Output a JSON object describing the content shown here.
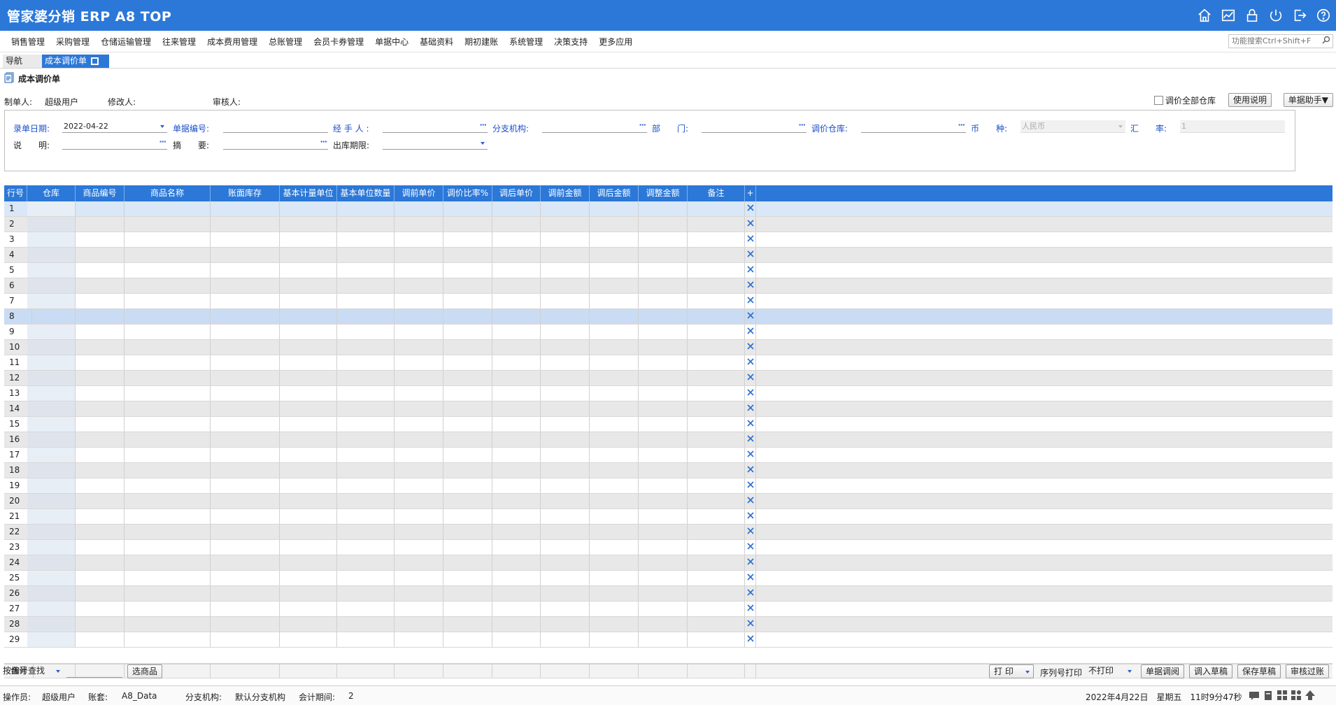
{
  "app": {
    "title": "管家婆分销 ERP A8 TOP"
  },
  "title_icons": [
    "home-icon",
    "chart-icon",
    "lock-icon",
    "power-icon",
    "exit-icon",
    "help-icon"
  ],
  "menu": [
    "销售管理",
    "采购管理",
    "仓储运输管理",
    "往来管理",
    "成本费用管理",
    "总账管理",
    "会员卡券管理",
    "单据中心",
    "基础资料",
    "期初建账",
    "系统管理",
    "决策支持",
    "更多应用"
  ],
  "search": {
    "placeholder": "功能搜索Ctrl+Shift+F"
  },
  "tabs": {
    "nav": "导航",
    "active": "成本调价单"
  },
  "page": {
    "title": "成本调价单"
  },
  "info": {
    "maker_label": "制单人:",
    "maker_value": "超级用户",
    "modifier_label": "修改人:",
    "auditor_label": "审核人:",
    "all_wh_label": "调价全部仓库",
    "help_button": "使用说明",
    "assist_button": "单据助手▼"
  },
  "form": {
    "date_label": "录单日期:",
    "date_value": "2022-04-22",
    "billno_label": "单据编号:",
    "handler_label": "经 手 人 :",
    "branch_label": "分支机构:",
    "dept_label": "部　　门:",
    "warehouse_label": "调价仓库:",
    "currency_label": "币　　种:",
    "currency_value": "人民币",
    "rate_label": "汇　　率:",
    "rate_value": "1",
    "desc_label": "说　　明:",
    "summary_label": "摘　　要:",
    "outlimit_label": "出库期限:"
  },
  "grid": {
    "columns": [
      "行号",
      "仓库",
      "商品编号",
      "商品名称",
      "账面库存",
      "基本计量单位",
      "基本单位数量",
      "调前单价",
      "调价比率%",
      "调后单价",
      "调前金额",
      "调后金额",
      "调整金额",
      "备注",
      "+"
    ],
    "rows": [
      "1",
      "2",
      "3",
      "4",
      "5",
      "6",
      "7",
      "8",
      "9",
      "10",
      "11",
      "12",
      "13",
      "14",
      "15",
      "16",
      "17",
      "18",
      "19",
      "20",
      "21",
      "22",
      "23",
      "24",
      "25",
      "26",
      "27",
      "28",
      "29"
    ],
    "selected_row": 8,
    "total_label": "合计"
  },
  "bottom": {
    "search_mode": "按编号查找",
    "select_goods": "选商品",
    "print": "打 印",
    "serial_print_label": "序列号打印",
    "serial_print_value": "不打印",
    "btn_query": "单据调阅",
    "btn_import_draft": "调入草稿",
    "btn_save_draft": "保存草稿",
    "btn_post": "审核过账"
  },
  "status": {
    "operator_label": "操作员:",
    "operator_value": "超级用户",
    "account_label": "账套:",
    "account_value": "A8_Data",
    "branch_label": "分支机构:",
    "branch_value": "默认分支机构",
    "period_label": "会计期间:",
    "period_value": "2",
    "datetime": "2022年4月22日　星期五　11时9分47秒"
  }
}
